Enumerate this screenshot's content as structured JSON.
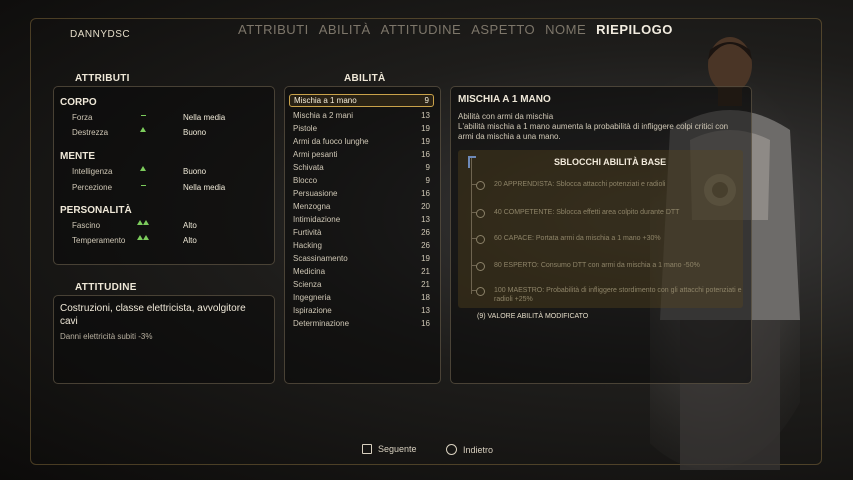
{
  "header": {
    "player_name": "DANNYDSC",
    "tabs": [
      {
        "label": "ATTRIBUTI",
        "active": false
      },
      {
        "label": "ABILITÀ",
        "active": false
      },
      {
        "label": "ATTITUDINE",
        "active": false
      },
      {
        "label": "ASPETTO",
        "active": false
      },
      {
        "label": "NOME",
        "active": false
      },
      {
        "label": "RIEPILOGO",
        "active": true
      }
    ]
  },
  "attributes": {
    "title": "ATTRIBUTI",
    "groups": [
      {
        "name": "CORPO",
        "items": [
          {
            "name": "Forza",
            "indicator": "dash",
            "value": "Nella media"
          },
          {
            "name": "Destrezza",
            "indicator": "up",
            "value": "Buono"
          }
        ]
      },
      {
        "name": "MENTE",
        "items": [
          {
            "name": "Intelligenza",
            "indicator": "up",
            "value": "Buono"
          },
          {
            "name": "Percezione",
            "indicator": "dash",
            "value": "Nella media"
          }
        ]
      },
      {
        "name": "PERSONALITÀ",
        "items": [
          {
            "name": "Fascino",
            "indicator": "double-up",
            "value": "Alto"
          },
          {
            "name": "Temperamento",
            "indicator": "double-up",
            "value": "Alto"
          }
        ]
      }
    ]
  },
  "attitude": {
    "title": "ATTITUDINE",
    "text": "Costruzioni, classe elettricista, avvolgitore cavi",
    "effect": "Danni elettricità subiti -3%"
  },
  "skills": {
    "title": "ABILITÀ",
    "items": [
      {
        "name": "Mischia a 1 mano",
        "value": "9",
        "selected": true
      },
      {
        "name": "Mischia a 2 mani",
        "value": "13"
      },
      {
        "name": "Pistole",
        "value": "19"
      },
      {
        "name": "Armi da fuoco lunghe",
        "value": "19"
      },
      {
        "name": "Armi pesanti",
        "value": "16"
      },
      {
        "name": "Schivata",
        "value": "9"
      },
      {
        "name": "Blocco",
        "value": "9"
      },
      {
        "name": "Persuasione",
        "value": "16"
      },
      {
        "name": "Menzogna",
        "value": "20"
      },
      {
        "name": "Intimidazione",
        "value": "13"
      },
      {
        "name": "Furtività",
        "value": "26"
      },
      {
        "name": "Hacking",
        "value": "26"
      },
      {
        "name": "Scassinamento",
        "value": "19"
      },
      {
        "name": "Medicina",
        "value": "21"
      },
      {
        "name": "Scienza",
        "value": "21"
      },
      {
        "name": "Ingegneria",
        "value": "18"
      },
      {
        "name": "Ispirazione",
        "value": "13"
      },
      {
        "name": "Determinazione",
        "value": "16"
      }
    ]
  },
  "detail": {
    "title": "MISCHIA A 1 MANO",
    "description": "Abilità con armi da mischia\nL'abilità mischia a 1 mano aumenta la probabilità di infliggere colpi critici con armi da mischia a una mano.",
    "unlocks_title": "SBLOCCHI ABILITÀ BASE",
    "unlocks": [
      "20 APPRENDISTA: Sblocca attacchi potenziati e radioli",
      "40 COMPETENTE: Sblocca effetti area colpito durante DTT",
      "60 CAPACE: Portata armi da mischia a 1 mano +30%",
      "80 ESPERTO: Consumo DTT con armi da mischia a 1 mano -50%",
      "100 MAESTRO: Probabilità di infliggere stordimento con gli attacchi potenziati e radioli +25%"
    ],
    "modified_note": "(9) VALORE ABILITÀ MODIFICATO"
  },
  "footer": {
    "next_label": "Seguente",
    "back_label": "Indietro"
  },
  "colors": {
    "accent_gold": "#c9a24a",
    "increase_green": "#7ccc5c"
  }
}
